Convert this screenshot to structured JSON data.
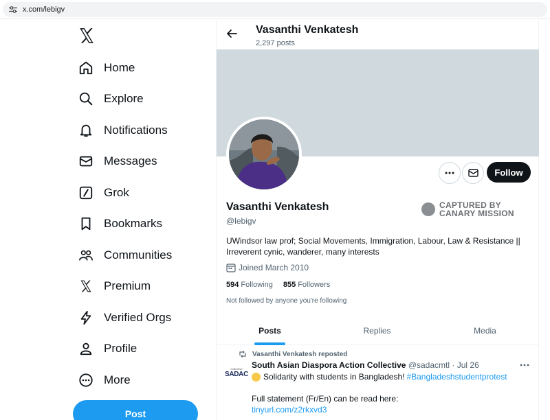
{
  "browser": {
    "url": "x.com/lebigv"
  },
  "sidebar": {
    "items": [
      {
        "label": "Home",
        "icon": "home-icon"
      },
      {
        "label": "Explore",
        "icon": "search-icon"
      },
      {
        "label": "Notifications",
        "icon": "bell-icon"
      },
      {
        "label": "Messages",
        "icon": "envelope-icon"
      },
      {
        "label": "Grok",
        "icon": "grok-icon"
      },
      {
        "label": "Bookmarks",
        "icon": "bookmark-icon"
      },
      {
        "label": "Communities",
        "icon": "people-icon"
      },
      {
        "label": "Premium",
        "icon": "x-logo-icon"
      },
      {
        "label": "Verified Orgs",
        "icon": "lightning-icon"
      },
      {
        "label": "Profile",
        "icon": "person-icon"
      },
      {
        "label": "More",
        "icon": "more-circle-icon"
      }
    ],
    "post_label": "Post"
  },
  "header": {
    "name": "Vasanthi Venkatesh",
    "posts_count": "2,297 posts"
  },
  "profile": {
    "name": "Vasanthi Venkatesh",
    "handle": "@lebigv",
    "bio": "UWindsor law prof; Social Movements, Immigration, Labour, Law & Resistance || Irreverent cynic, wanderer, many interests",
    "joined": "Joined March 2010",
    "following_count": "594",
    "following_label": "Following",
    "followers_count": "855",
    "followers_label": "Followers",
    "not_followed": "Not followed by anyone you're following",
    "follow_label": "Follow"
  },
  "watermark": {
    "line1": "CAPTURED BY",
    "line2": "CANARY MISSION"
  },
  "tabs": [
    "Posts",
    "Replies",
    "Media"
  ],
  "tweet": {
    "repost_label": "Vasanthi Venkatesh reposted",
    "author": "South Asian Diaspora Action Collective",
    "handle": "@sadacmtl",
    "date": "Jul 26",
    "line1": "Solidarity with students in Bangladesh!",
    "hashtag": "#Bangladeshstudentprotest",
    "line2": "Full statement (Fr/En) can be read here:",
    "link": "tinyurl.com/z2rkxvd3",
    "avatar_small": "Collective",
    "avatar_text": "SADAC"
  },
  "colors": {
    "accent": "#1d9bf0",
    "banner": "#cfd9de",
    "text": "#0f1419",
    "muted": "#536471"
  }
}
